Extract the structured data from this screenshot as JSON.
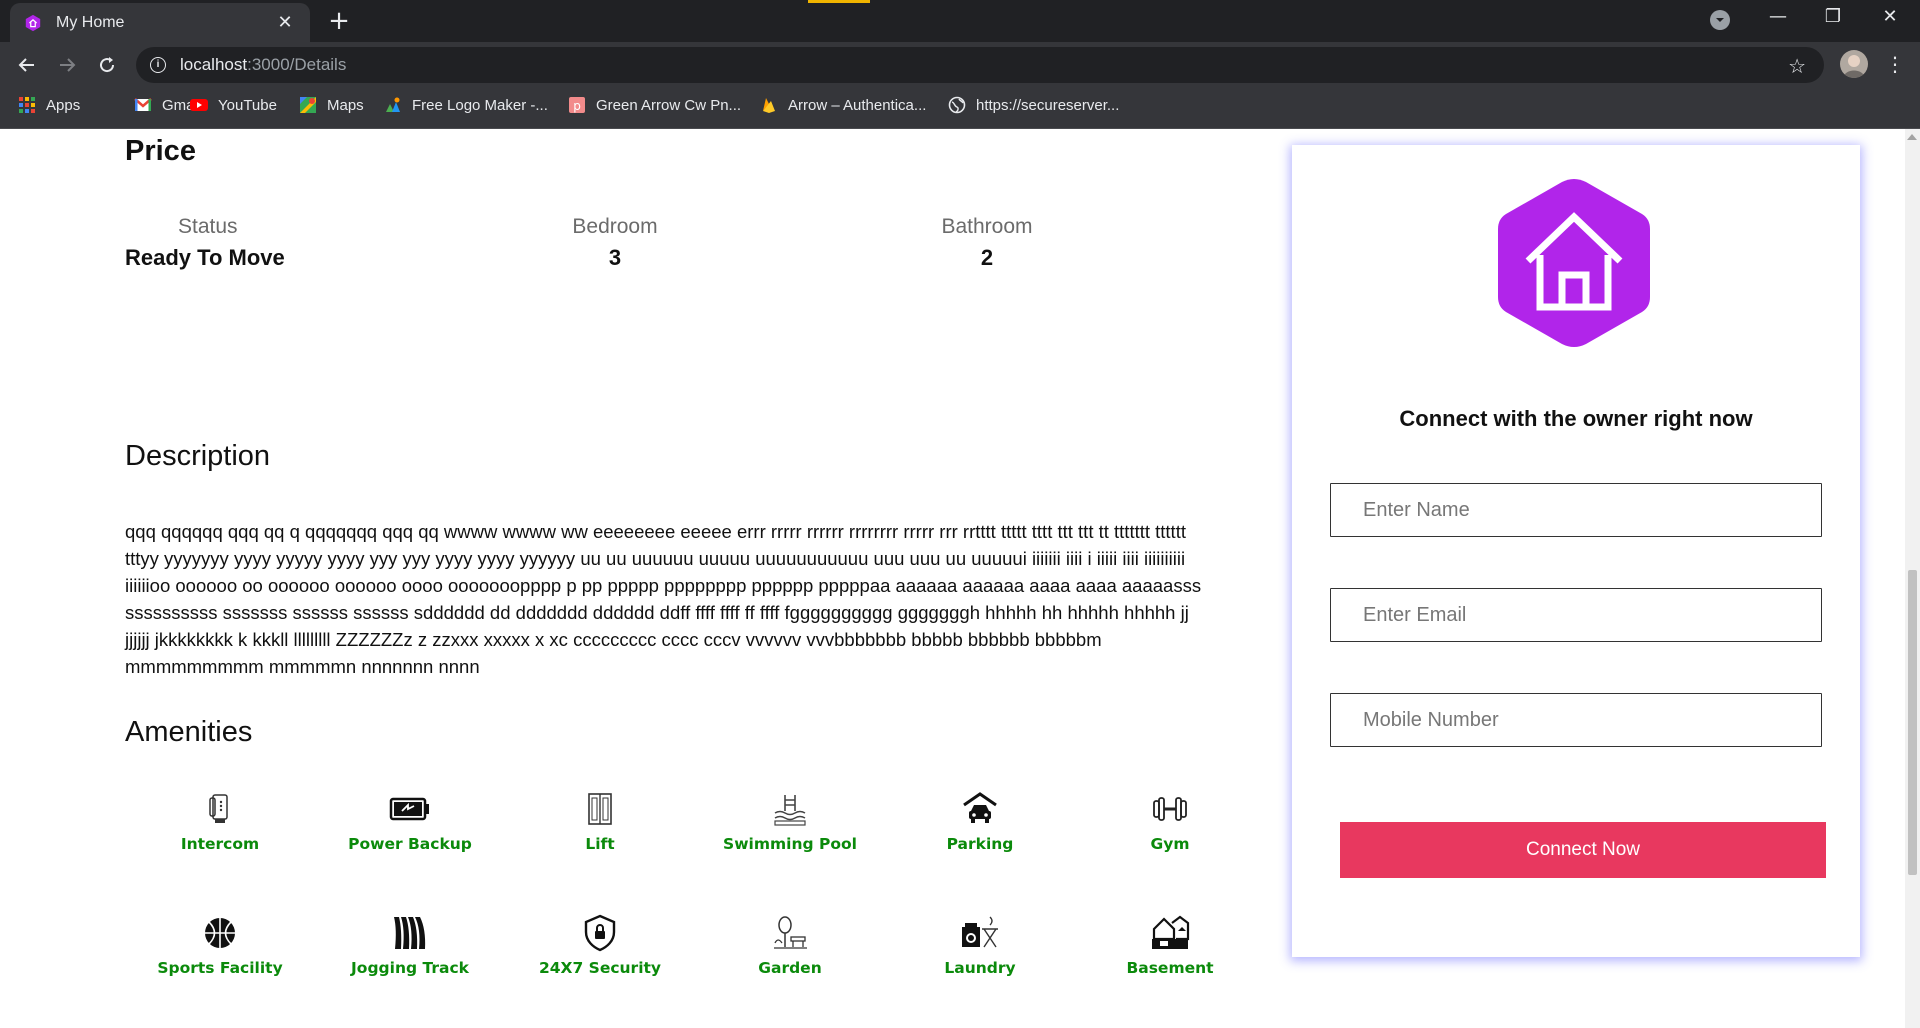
{
  "browser": {
    "tab_title": "My Home",
    "tab_close": "✕",
    "new_tab": "+",
    "url_host": "localhost",
    "url_path": ":3000/Details",
    "window_controls": {
      "minimize": "—",
      "restore": "❐",
      "close": "✕"
    },
    "bookmarks": [
      {
        "label": "Apps",
        "icon": "apps-grid-icon"
      },
      {
        "label": "Gmail",
        "icon": "gmail-icon"
      },
      {
        "label": "YouTube",
        "icon": "youtube-icon"
      },
      {
        "label": "Maps",
        "icon": "maps-icon"
      },
      {
        "label": "Free Logo Maker -...",
        "icon": "logo-maker-icon"
      },
      {
        "label": "Green Arrow Cw Pn...",
        "icon": "pinterest-icon"
      },
      {
        "label": "Arrow – Authentica...",
        "icon": "firebase-icon"
      },
      {
        "label": "https://secureserver...",
        "icon": "globe-icon"
      }
    ]
  },
  "price": {
    "title": "Price",
    "stats": [
      {
        "label": "Status",
        "value": "Ready To Move"
      },
      {
        "label": "Bedroom",
        "value": "3"
      },
      {
        "label": "Bathroom",
        "value": "2"
      }
    ]
  },
  "description": {
    "title": "Description",
    "text": "qqq qqqqqq qqq qq q qqqqqqq qqq qq wwww wwww ww eeeeeeee eeeee errr rrrrr rrrrrr rrrrrrrr rrrrr rrr rrtttt ttttt tttt ttt ttt tt ttttttt tttttt tttyy yyyyyyy yyyy yyyyy yyyy yyy yyy yyyy yyyy yyyyyy uu uu uuuuuu uuuuu uuuuuuuuuuu uuu uuu uu uuuuui iiiiiii iiii i iiiii iiii iiiiiiiiii iiiiiioo oooooo oo oooooo oooooo oooo ooooooopppp p pp ppppp pppppppp pppppp pppppaa aaaaaa aaaaaa aaaa aaaa aaaaasss ssssssssss sssssss ssssss ssssss sdddddd dd ddddddd dddddd ddff ffff ffff ff ffff fgggggggggg gggggggh hhhhh hh hhhhh hhhhh jj jjjjjj jkkkkkkkk k kkkll lllllllll ZZZZZZz z zzxxx xxxxx x xc ccccccccc cccc cccv vvvvvv vvvbbbbbbb bbbbb bbbbbb bbbbbm mmmmmmmmm mmmmmn nnnnnnn nnnn"
  },
  "amenities": {
    "title": "Amenities",
    "items": [
      {
        "label": "Intercom",
        "icon": "intercom-icon"
      },
      {
        "label": "Power Backup",
        "icon": "battery-icon"
      },
      {
        "label": "Lift",
        "icon": "lift-icon"
      },
      {
        "label": "Swimming Pool",
        "icon": "pool-icon"
      },
      {
        "label": "Parking",
        "icon": "car-garage-icon"
      },
      {
        "label": "Gym",
        "icon": "dumbbell-icon"
      },
      {
        "label": "Sports Facility",
        "icon": "basketball-icon"
      },
      {
        "label": "Jogging Track",
        "icon": "track-icon"
      },
      {
        "label": "24X7 Security",
        "icon": "shield-lock-icon"
      },
      {
        "label": "Garden",
        "icon": "garden-icon"
      },
      {
        "label": "Laundry",
        "icon": "laundry-icon"
      },
      {
        "label": "Basement",
        "icon": "basement-icon"
      }
    ],
    "label_color": "#0b8a0b"
  },
  "contact_card": {
    "title": "Connect with the owner right now",
    "name_placeholder": "Enter Name",
    "email_placeholder": "Enter Email",
    "mobile_placeholder": "Mobile Number",
    "button_label": "Connect Now",
    "logo_icon": "house-hexagon-icon",
    "accent_color": "#b125ea",
    "button_color": "#e8385f"
  }
}
